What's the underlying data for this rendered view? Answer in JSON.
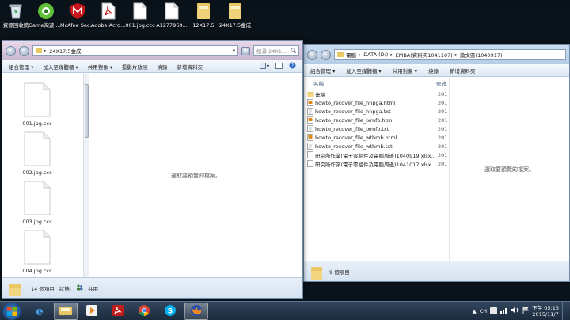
{
  "desktop_icons": [
    {
      "label": "資源回收筒",
      "icon": "recycle-bin-icon"
    },
    {
      "label": "Game淘遊 盛大廳",
      "icon": "game-icon"
    },
    {
      "label": "McAfee Securit...",
      "icon": "mcafee-icon"
    },
    {
      "label": "Adobe Acrobat...",
      "icon": "acrobat-icon"
    },
    {
      "label": "001.jpg.ccc",
      "icon": "file-icon"
    },
    {
      "label": "A1277969...",
      "icon": "file-icon"
    },
    {
      "label": "12X17.5",
      "icon": "folder-icon"
    },
    {
      "label": "24X17.5金成",
      "icon": "folder-icon"
    }
  ],
  "right_window": {
    "address_parts": [
      "電腦",
      "DATA (D:)",
      "EMBA(資料夾1041107)",
      "論文區(1040917)"
    ],
    "toolbar": [
      "組合管理 ▾",
      "加入至媒體櫃 ▾",
      "共用對象 ▾",
      "燒錄",
      "新增資料夾"
    ],
    "columns": {
      "name": "名稱",
      "date": "修改"
    },
    "files": [
      {
        "name": "畫稿",
        "date": "201",
        "type": "folder"
      },
      {
        "name": "howto_recover_file_hnpga.html",
        "date": "201",
        "type": "html"
      },
      {
        "name": "howto_recover_file_hnpga.txt",
        "date": "201",
        "type": "txt"
      },
      {
        "name": "howto_recover_file_ixmfo.html",
        "date": "201",
        "type": "html"
      },
      {
        "name": "howto_recover_file_ixmfo.txt",
        "date": "201",
        "type": "txt"
      },
      {
        "name": "howto_recover_file_wthmb.html",
        "date": "201",
        "type": "html"
      },
      {
        "name": "howto_recover_file_wthmb.txt",
        "date": "201",
        "type": "txt"
      },
      {
        "name": "研究所作業(電子零組件及電腦周邊)1040919.xlsx.ccc",
        "date": "201",
        "type": "file"
      },
      {
        "name": "研究所作業(電子零組件及電腦周邊)1041017.xlsx.ccc",
        "date": "201",
        "type": "file"
      }
    ],
    "preview_text": "選取要預覽的檔案。",
    "status_count": "9 個項目"
  },
  "left_window": {
    "address": "24X17.5金成",
    "search_placeholder": "搜尋 24X1...",
    "toolbar": [
      "組合管理 ▾",
      "加入至媒體櫃 ▾",
      "共用對象 ▾",
      "投影片放映",
      "燒錄",
      "新增資料夾"
    ],
    "thumbnails": [
      "001.jpg.ccc",
      "002.jpg.ccc",
      "003.jpg.ccc",
      "004.jpg.ccc"
    ],
    "preview_text": "選取要預覽的檔案。",
    "status_count": "14 個項目",
    "status_state_label": "狀態:",
    "status_state_value": "共用"
  },
  "taskbar": {
    "apps": [
      "ie-icon",
      "explorer-icon",
      "media-player-icon",
      "acrobat-icon",
      "chrome-icon",
      "skype-icon",
      "firefox-icon"
    ],
    "lang": "CH",
    "time": "下午 05:15",
    "date": "2015/11/7"
  }
}
